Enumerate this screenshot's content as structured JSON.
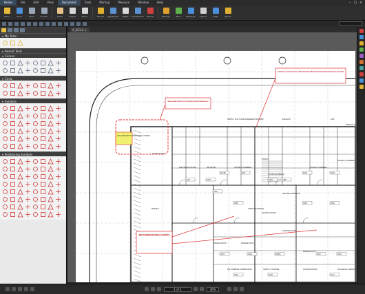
{
  "menu": {
    "items": [
      {
        "label": "Home",
        "active": true
      },
      {
        "label": "File"
      },
      {
        "label": "Edit"
      },
      {
        "label": "View"
      },
      {
        "label": "Document"
      },
      {
        "label": "Tools"
      },
      {
        "label": "Markup"
      },
      {
        "label": "Measure"
      },
      {
        "label": "Window"
      },
      {
        "label": "Help"
      }
    ]
  },
  "ribbon": {
    "buttons": [
      {
        "label": "Open",
        "icon": "folder-open-icon",
        "color": "#e7b93c"
      },
      {
        "label": "Save",
        "icon": "save-icon",
        "color": "#4a8fd8"
      },
      {
        "label": "Print",
        "icon": "print-icon",
        "color": "#9aa7b8"
      },
      {
        "label": "E-mail",
        "icon": "email-icon",
        "color": "#9aa7b8"
      },
      {
        "label": "Hand",
        "icon": "hand-icon",
        "color": "#e8c08a"
      },
      {
        "label": "Select",
        "icon": "select-arrow-icon",
        "color": "#d8d8d8"
      },
      {
        "label": "Zoom",
        "icon": "zoom-icon",
        "color": "#d8d8d8"
      },
      {
        "label": "Secure",
        "icon": "secure-icon",
        "color": "#e0b030"
      },
      {
        "label": "Signatures",
        "icon": "signature-icon",
        "color": "#5a90d0"
      },
      {
        "label": "Pages",
        "icon": "pages-icon",
        "color": "#d8d8d8"
      },
      {
        "label": "Comparison",
        "icon": "comparison-icon",
        "color": "#5a90d0"
      },
      {
        "label": "Reuse",
        "icon": "reuse-icon",
        "color": "#d04040"
      },
      {
        "label": "Markup",
        "icon": "markup-icon",
        "color": "#e0a030"
      },
      {
        "label": "Pens",
        "icon": "pen-icon",
        "color": "#60b050"
      },
      {
        "label": "Measure",
        "icon": "measure-icon",
        "color": "#4a90d8"
      },
      {
        "label": "Layers",
        "icon": "layers-icon",
        "color": "#d0d0d0"
      },
      {
        "label": "OCR",
        "icon": "ocr-icon",
        "color": "#4a90d8"
      },
      {
        "label": "Studio",
        "icon": "studio-icon",
        "color": "#e0b030"
      }
    ]
  },
  "search": {
    "placeholder": ""
  },
  "tool_chest": {
    "sections": [
      {
        "title": "My Tools",
        "kind": "yellow"
      },
      {
        "title": "Recent Tools",
        "kind": "empty"
      },
      {
        "title": "Curves",
        "kind": "gray"
      },
      {
        "title": "Circle",
        "kind": "red"
      },
      {
        "title": "Symbols",
        "kind": "red"
      },
      {
        "title": "Positioning Symbols",
        "kind": "red"
      }
    ]
  },
  "document": {
    "tab_label": "A_301.2 ×"
  },
  "drawing": {
    "callouts": [
      "Provide for some expansion/movement at line of foundation walls below within planter walls and selected pavement material.",
      "Lighten sidewalk in a reinforcement strength and sight lines with barricade system",
      "Detail all doors at courtroom interior to be fabricated by millwork to GFH to allow for proper veneer matching - Ex. 0136A, B and C"
    ],
    "labels": [
      "HIGH SECURITY BARRICADE SYSTEM",
      "SUPPLY DUCT UP/DN GENERATOR ROOM",
      "EXHAUST",
      "UPS",
      "EXHAUST AIR",
      "COILING DOOR",
      "ELECTRICAL ROOM",
      "IDF ROOM",
      "JUDGE'S CHAMBER",
      "STAIR 3",
      "JUDGE'S CHAMBER",
      "JUDGE'S CHAMBER",
      "STAIR VESTIBULE",
      "SECURE CORRIDOR",
      "RAMP 2",
      "SUPPLY STORAGE",
      "HOLDING ROOM",
      "FEMALE DOCK",
      "FEMALE DOCK",
      "HOLDING ROOM",
      "FEMALE DOCK",
      "D11 CRIMINAL SUPERVISION",
      "SUPPLY STORAGE",
      "HOLDING ROOM",
      "D12 FELONY ARRAIGNMENT"
    ],
    "rooms": [
      "0171B",
      "0173",
      "0175",
      "0170",
      "0176",
      "0178",
      "0169",
      "0168",
      "0160",
      "0155",
      "0154",
      "0152",
      "0133",
      "0134",
      "0136A",
      "0137",
      "0140",
      "0142",
      "0145",
      "0147"
    ]
  },
  "status": {
    "page": "1 of 1",
    "zoom": "36%"
  }
}
